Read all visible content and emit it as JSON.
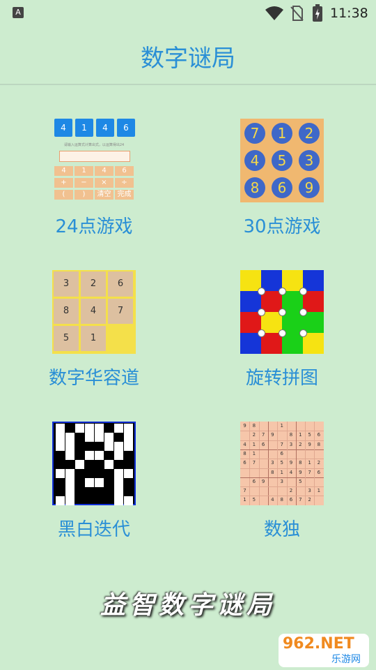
{
  "status_bar": {
    "time": "11:38",
    "notification_icon": "A"
  },
  "header": {
    "title": "数字谜局"
  },
  "games": [
    {
      "label": "24点游戏"
    },
    {
      "label": "30点游戏"
    },
    {
      "label": "数字华容道"
    },
    {
      "label": "旋转拼图"
    },
    {
      "label": "黑白迭代"
    },
    {
      "label": "数独"
    }
  ],
  "preview_24": {
    "numbers": [
      "4",
      "1",
      "4",
      "6"
    ],
    "hint": "请输入运算式计算出式，以运算得出24",
    "keys": [
      "4",
      "1",
      "4",
      "6",
      "+",
      "−",
      "×",
      "÷",
      "(",
      ")",
      "清空",
      "完成"
    ]
  },
  "preview_30": {
    "numbers": [
      "7",
      "1",
      "2",
      "4",
      "5",
      "3",
      "8",
      "6",
      "9"
    ]
  },
  "preview_klotski": {
    "numbers": [
      "3",
      "2",
      "6",
      "8",
      "4",
      "7",
      "5",
      "1",
      ""
    ]
  },
  "preview_rotate": {
    "colors": [
      "#f6e312",
      "#1535d8",
      "#f6e312",
      "#1535d8",
      "#1535d8",
      "#e01818",
      "#1ad018",
      "#e01818",
      "#e01818",
      "#f6e312",
      "#1ad018",
      "#1ad018",
      "#1535d8",
      "#e01818",
      "#1ad018",
      "#f6e312"
    ]
  },
  "preview_bw": {
    "pattern": [
      "10111011",
      "11011101",
      "11000111",
      "01011010",
      "00100100",
      "11000011",
      "01011010",
      "01000010",
      "11000011"
    ]
  },
  "preview_sudoku": {
    "rows": [
      "98  1    ",
      " 279 8156",
      "416 73298",
      "81  6    ",
      "67 359812",
      "   814976",
      " 69 3 5  ",
      "7    2 31",
      "15 48672 "
    ]
  },
  "bottom_banner": {
    "text": "益智数字谜局"
  },
  "watermark": {
    "brand": "962.NET",
    "sub": "乐游网"
  },
  "colors": {
    "background": "#cdeccf",
    "accent": "#2a8fd6"
  }
}
